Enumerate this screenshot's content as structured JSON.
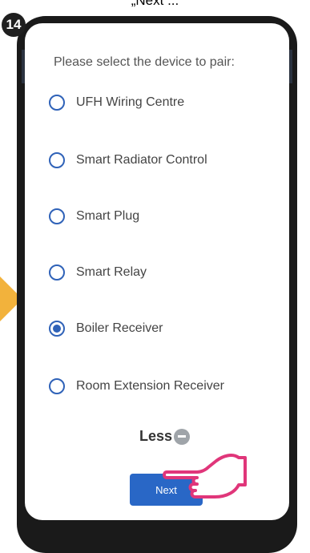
{
  "instruction": {
    "caption": "„Next ...",
    "step_number": "14"
  },
  "pairing": {
    "prompt": "Please select the device to pair:",
    "options": [
      {
        "label": "UFH Wiring Centre",
        "selected": false
      },
      {
        "label": "Smart Radiator Control",
        "selected": false
      },
      {
        "label": "Smart Plug",
        "selected": false
      },
      {
        "label": "Smart Relay",
        "selected": false
      },
      {
        "label": "Boiler Receiver",
        "selected": true
      },
      {
        "label": "Room Extension Receiver",
        "selected": false
      }
    ],
    "less_label": "Less",
    "next_label": "Next"
  },
  "colors": {
    "accent": "#2967c6",
    "badge": "#1f1f1f",
    "arrow": "#f2b23c",
    "pointer": "#e0367a"
  },
  "icons": {
    "collapse": "minus-circle-icon",
    "pointer": "pointing-hand-icon"
  }
}
